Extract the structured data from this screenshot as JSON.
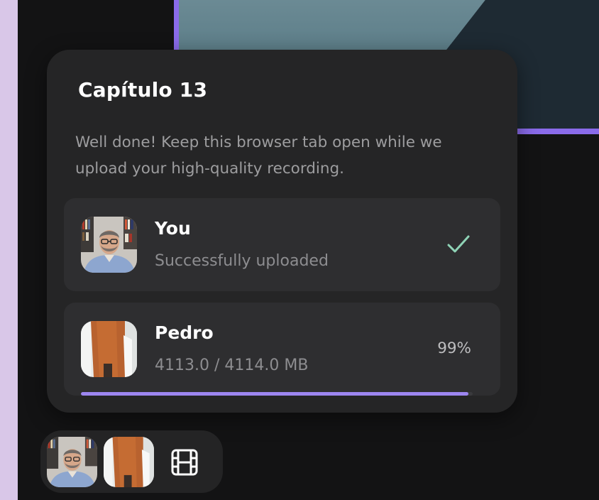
{
  "dialog": {
    "title": "Capítulo 13",
    "description": "Well done! Keep this browser tab open while we upload your high-quality recording."
  },
  "uploads": [
    {
      "name": "You",
      "status": "Successfully uploaded",
      "state_icon": "checkmark-icon"
    },
    {
      "name": "Pedro",
      "size": "4113.0 / 4114.0 MB",
      "percent": "99%",
      "progress": 0.99
    }
  ],
  "toolbar": {
    "icons": [
      "participant-you-avatar",
      "participant-pedro-avatar",
      "film-icon"
    ]
  },
  "colors": {
    "accent": "#8a6bea",
    "progress": "#9d86f0",
    "check": "#8fd3b6",
    "card": "#252526",
    "row": "#2e2e30"
  }
}
